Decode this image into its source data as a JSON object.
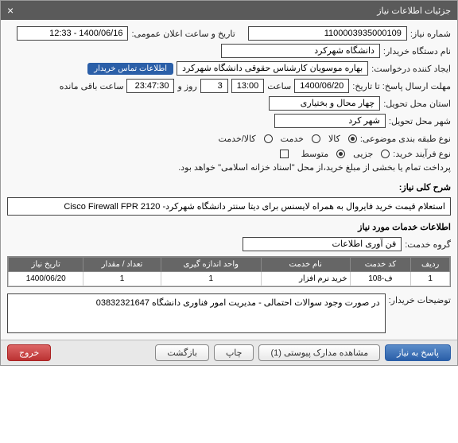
{
  "titlebar": {
    "title": "جزئیات اطلاعات نیاز"
  },
  "f": {
    "req_no_label": "شماره نیاز:",
    "req_no": "1100003935000109",
    "announce_label": "تاریخ و ساعت اعلان عمومی:",
    "announce": "1400/06/16 - 12:33",
    "buyer_label": "نام دستگاه خریدار:",
    "buyer": "دانشگاه شهرکرد",
    "requester_label": "ایجاد کننده درخواست:",
    "requester": "بهاره موسویان کارشناس حقوقی دانشگاه شهرکرد",
    "contact_btn": "اطلاعات تماس خریدار",
    "deadline_label": "مهلت ارسال پاسخ: تا تاریخ:",
    "deadline_date": "1400/06/20",
    "hour_label": "ساعت",
    "deadline_hour": "13:00",
    "day_label": "روز و",
    "days": "3",
    "remain_time": "23:47:30",
    "remain_label": "ساعت باقی مانده",
    "province_label": "استان محل تحویل:",
    "province": "چهار محال و بختیاری",
    "city_label": "شهر محل تحویل:",
    "city": "شهر کرد",
    "subject_label": "نوع طبقه بندی موضوعی:",
    "r_kala": "کالا",
    "r_khadamat": "خدمت",
    "r_both": "کالا/خدمت",
    "process_label": "نوع فرآیند خرید:",
    "p_small": "جزیی",
    "p_medium": "متوسط",
    "pay_note": "پرداخت تمام یا بخشی از مبلغ خرید،از محل \"اسناد خزانه اسلامی\" خواهد بود.",
    "desc_label": "شرح کلی نیاز:",
    "desc": "استعلام قیمت خرید فایروال به همراه لایسنس برای دیتا سنتر دانشگاه شهرکرد- Cisco Firewall  FPR 2120",
    "items_header": "اطلاعات خدمات مورد نیاز",
    "group_label": "گروه خدمت:",
    "group": "فن آوری اطلاعات",
    "notes_label": "توضیحات خریدار:",
    "notes": "در صورت وجود سوالات احتمالی - مدیریت امور فناوری دانشگاه  03832321647"
  },
  "table": {
    "headers": [
      "ردیف",
      "کد خدمت",
      "نام خدمت",
      "واحد اندازه گیری",
      "تعداد / مقدار",
      "تاریخ نیاز"
    ],
    "rows": [
      {
        "c": [
          "1",
          "ف-108",
          "خرید نرم افزار",
          "1",
          "1",
          "1400/06/20"
        ]
      }
    ]
  },
  "btns": {
    "respond": "پاسخ به نیاز",
    "attachments": "مشاهده مدارک پیوستی  (1)",
    "print": "چاپ",
    "back": "بازگشت",
    "exit": "خروج"
  }
}
